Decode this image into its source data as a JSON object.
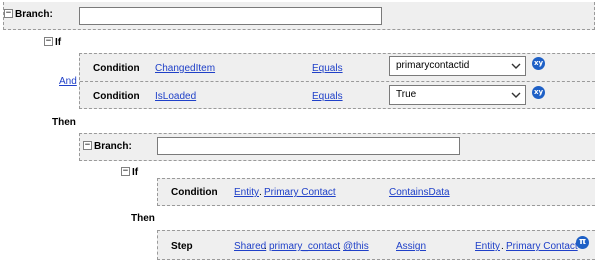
{
  "root": {
    "label": "Branch:",
    "input_value": ""
  },
  "if1": {
    "label": "If",
    "and_label": "And",
    "conditions": [
      {
        "label": "Condition",
        "field": "ChangedItem",
        "operator": "Equals",
        "value": "primarycontactid",
        "badge": "xy"
      },
      {
        "label": "Condition",
        "field": "IsLoaded",
        "operator": "Equals",
        "value": "True",
        "badge": "xy"
      }
    ]
  },
  "then1": {
    "label": "Then"
  },
  "branch2": {
    "label": "Branch:",
    "input_value": ""
  },
  "if2": {
    "label": "If",
    "condition": {
      "label": "Condition",
      "entity": "Entity",
      "sep": ".",
      "field": "Primary Contact",
      "operator": "ContainsData"
    }
  },
  "then2": {
    "label": "Then",
    "step": {
      "label": "Step",
      "scope": "Shared",
      "sep1": ".",
      "variable": "primary_contact",
      "sep2": ".",
      "member": "@this",
      "action": "Assign",
      "target_entity": "Entity",
      "sep3": ".",
      "target_field": "Primary Contact",
      "badge": "π"
    }
  },
  "colors": {
    "link": "#1f40c8",
    "badge": "#1e60c6",
    "panel": "#efefef"
  }
}
